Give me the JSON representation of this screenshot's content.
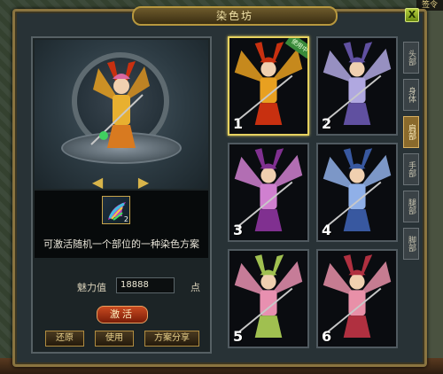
{
  "corner_label": "签令",
  "window": {
    "title": "染色坊",
    "close_label": "X"
  },
  "preview": {
    "left_arrow": "◀",
    "right_arrow": "▶"
  },
  "item": {
    "count": "2",
    "description": "可激活随机一个部位的一种染色方案"
  },
  "charm": {
    "label": "魅力值",
    "value": "18888",
    "unit": "点"
  },
  "buttons": {
    "activate": "激活",
    "restore": "还原",
    "apply": "使用",
    "share": "方案分享"
  },
  "slots": [
    {
      "num": "1",
      "color": "#e8a020",
      "accent": "#c83010",
      "selected": true,
      "badge": "使用中"
    },
    {
      "num": "2",
      "color": "#b0a8e0",
      "accent": "#6050a0",
      "selected": false
    },
    {
      "num": "3",
      "color": "#d080d0",
      "accent": "#803090",
      "selected": false
    },
    {
      "num": "4",
      "color": "#90b0e8",
      "accent": "#3858a0",
      "selected": false
    },
    {
      "num": "5",
      "color": "#e890b0",
      "accent": "#a0c050",
      "selected": false
    },
    {
      "num": "6",
      "color": "#e890a8",
      "accent": "#b03040",
      "selected": false
    }
  ],
  "tabs": [
    {
      "label": "头部",
      "active": false
    },
    {
      "label": "身体",
      "active": false
    },
    {
      "label": "肩部",
      "active": true
    },
    {
      "label": "手部",
      "active": false
    },
    {
      "label": "腿部",
      "active": false
    },
    {
      "label": "脚部",
      "active": false
    }
  ]
}
